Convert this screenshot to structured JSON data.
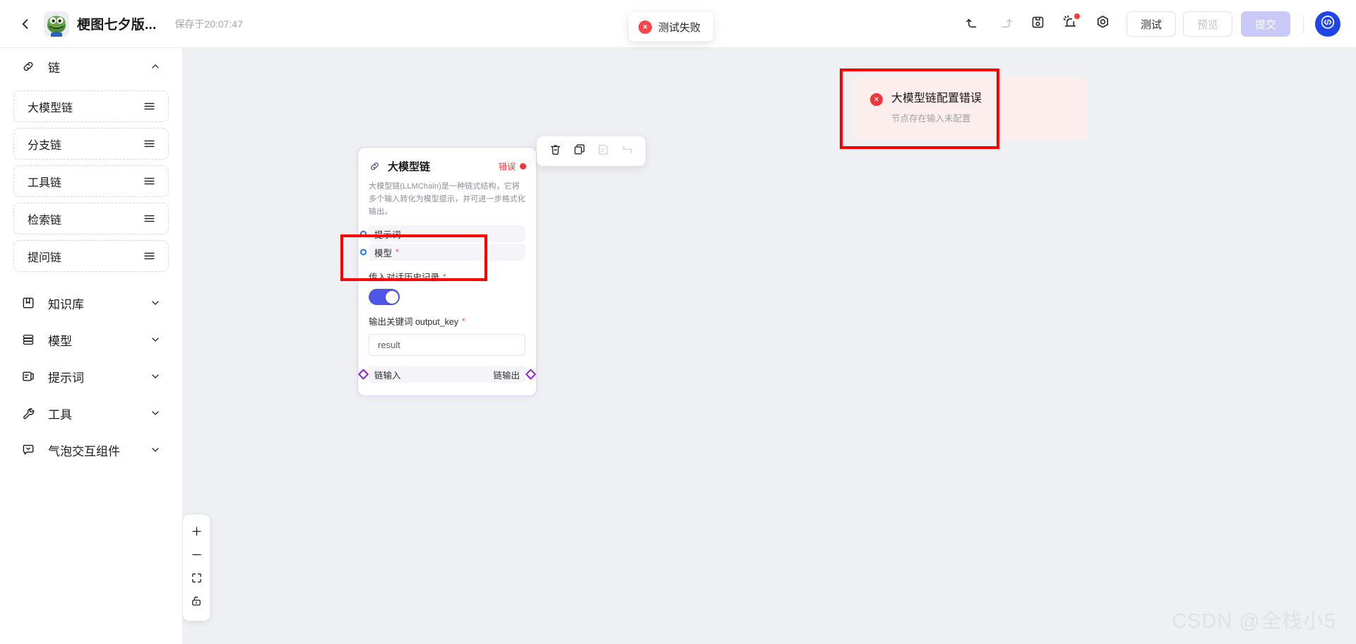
{
  "header": {
    "back_icon": "chevron-left-icon",
    "app_title": "梗图七夕版...",
    "saved_at": "保存于20:07:47",
    "toast": {
      "icon": "error-circle-icon",
      "text": "测试失败",
      "mark": "×"
    },
    "actions": {
      "undo": "undo-icon",
      "redo": "redo-icon",
      "save": "save-icon",
      "alarm": "alarm-icon",
      "settings": "gear-icon",
      "test_label": "测试",
      "preview_label": "预览",
      "submit_label": "提交",
      "code_icon": "code-bubble-icon"
    }
  },
  "sidebar": {
    "groups": [
      {
        "label": "链",
        "icon": "link-icon",
        "expanded": true,
        "caret": "chevron-up-icon",
        "items": [
          {
            "label": "大模型链",
            "grip": "grip-lines-icon"
          },
          {
            "label": "分支链",
            "grip": "grip-lines-icon"
          },
          {
            "label": "工具链",
            "grip": "grip-lines-icon"
          },
          {
            "label": "检索链",
            "grip": "grip-lines-icon"
          },
          {
            "label": "提问链",
            "grip": "grip-lines-icon"
          }
        ]
      },
      {
        "label": "知识库",
        "icon": "book-icon",
        "expanded": false,
        "caret": "chevron-down-icon",
        "items": []
      },
      {
        "label": "模型",
        "icon": "database-icon",
        "expanded": false,
        "caret": "chevron-down-icon",
        "items": []
      },
      {
        "label": "提示词",
        "icon": "document-icon",
        "expanded": false,
        "caret": "chevron-down-icon",
        "items": []
      },
      {
        "label": "工具",
        "icon": "wrench-icon",
        "expanded": false,
        "caret": "chevron-down-icon",
        "items": []
      },
      {
        "label": "气泡交互组件",
        "icon": "chat-bubble-icon",
        "expanded": false,
        "caret": "chevron-down-icon",
        "items": []
      }
    ]
  },
  "canvas": {
    "node_toolbar": [
      {
        "name": "delete-icon",
        "disabled": false
      },
      {
        "name": "copy-icon",
        "disabled": false
      },
      {
        "name": "note-icon",
        "disabled": true
      },
      {
        "name": "collapse-icon",
        "disabled": true
      }
    ],
    "node": {
      "icon": "link-icon",
      "title": "大模型链",
      "status_label": "错误",
      "status_color": "#f0353b",
      "description": "大模型链(LLMChain)是一种链式结构，它将多个输入转化为模型提示，并可进一步格式化输出。",
      "ports": [
        {
          "label": "提示词",
          "required": false
        },
        {
          "label": "模型",
          "required": true
        }
      ],
      "history_field": {
        "label": "传入对话历史记录",
        "required": true,
        "enabled": true
      },
      "output_key_field": {
        "label": "输出关键词 output_key",
        "required": true,
        "value": "result",
        "placeholder": "result"
      },
      "footer": {
        "input_label": "链输入",
        "output_label": "链输出"
      },
      "required_mark": "*"
    },
    "error_panel": {
      "icon": "error-circle-icon",
      "mark": "×",
      "title": "大模型链配置错误",
      "subtitle": "节点存在输入未配置"
    },
    "zoom_controls": [
      {
        "name": "zoom-in-icon"
      },
      {
        "name": "zoom-out-icon"
      },
      {
        "name": "fit-view-icon"
      },
      {
        "name": "lock-open-icon"
      }
    ],
    "watermark": "CSDN @全栈小5"
  },
  "colors": {
    "accent": "#4f55e8",
    "error": "#f0353b",
    "canvas_bg": "#eef0f4",
    "node_border": "#d7d6fb",
    "annotation": "#ff0000"
  }
}
